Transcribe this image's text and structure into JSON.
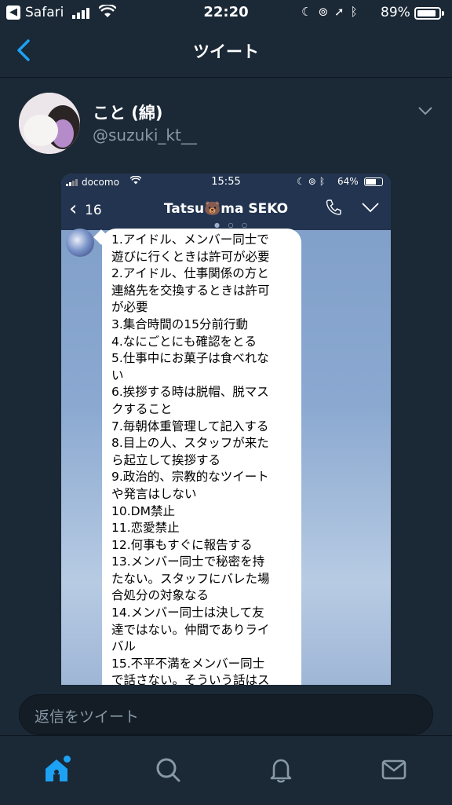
{
  "status_bar": {
    "back_app": "Safari",
    "time": "22:20",
    "battery": "89%",
    "battery_level": 0.89
  },
  "nav": {
    "title": "ツイート",
    "back_icon": "chevron-left-icon"
  },
  "tweet": {
    "author_name": "こと (綿)",
    "author_handle": "@suzuki_kt__",
    "menu_icon": "chevron-down-icon"
  },
  "embedded": {
    "carrier": "docomo",
    "time": "15:55",
    "battery": "64%",
    "battery_level": 0.64,
    "back_label": "‹",
    "unread_count": "16",
    "chat_title": "Tatsu🐻ma SEKO",
    "message_lines": [
      " 1.アイドル、メンバー同士で",
      "遊びに行くときは許可が必要",
      " 2.アイドル、仕事関係の方と",
      "連絡先を交換するときは許可",
      "が必要",
      " 3.集合時間の15分前行動",
      " 4.なにごとにも確認をとる",
      "5.仕事中にお菓子は食べれな",
      "い",
      "6.挨拶する時は脱帽、脱マス",
      "クすること",
      "7.毎朝体重管理して記入する",
      "8.目上の人、スタッフが来た",
      "ら起立して挨拶する",
      "9.政治的、宗教的なツイート",
      "や発言はしない",
      "10.DM禁止",
      "11.恋愛禁止",
      "12.何事もすぐに報告する",
      "13.メンバー同士で秘密を持",
      "たない。スタッフにバレた場",
      "合処分の対象なる",
      "14.メンバー同士は決して友",
      "達ではない。仲間でありライ",
      "バル",
      "15.不平不満をメンバー同士",
      "で話さない。そういう話はス"
    ]
  },
  "reply": {
    "placeholder": "返信をツイート"
  },
  "tabs": [
    {
      "name": "home-icon",
      "active": true
    },
    {
      "name": "search-icon",
      "active": false
    },
    {
      "name": "bell-icon",
      "active": false
    },
    {
      "name": "mail-icon",
      "active": false
    }
  ],
  "colors": {
    "background": "#1b2836",
    "accent": "#1da1f2",
    "secondary_text": "#8899a6"
  }
}
